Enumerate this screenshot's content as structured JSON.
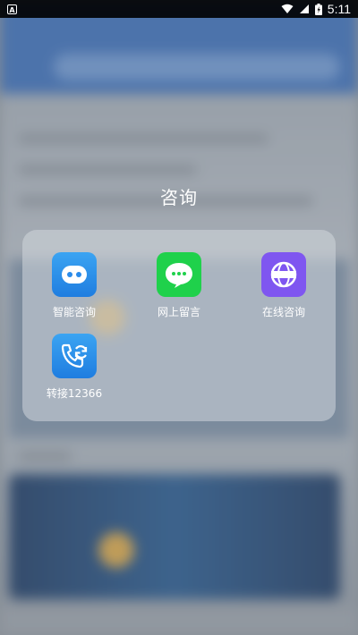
{
  "status_bar": {
    "notification": "A",
    "time": "5:11"
  },
  "folder": {
    "title": "咨询",
    "apps": [
      {
        "label": "智能咨询",
        "icon": "chat-bot-icon",
        "color": "#2b8ceb"
      },
      {
        "label": "网上留言",
        "icon": "message-bubble-icon",
        "color": "#1fd14b"
      },
      {
        "label": "在线咨询",
        "icon": "globe-icon",
        "color": "#7f56f0"
      },
      {
        "label": "转接12366",
        "icon": "phone-transfer-icon",
        "color": "#2b8ceb"
      }
    ]
  }
}
